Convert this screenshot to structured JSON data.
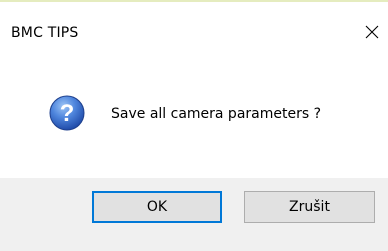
{
  "window": {
    "title": "BMC TIPS"
  },
  "icons": {
    "message_icon": "question-icon",
    "close_icon": "close-icon"
  },
  "message": {
    "text": "Save all camera parameters ?"
  },
  "buttons": {
    "ok_label": "OK",
    "cancel_label": "Zrušit"
  },
  "colors": {
    "question_icon_gradient_light": "#6f9fe6",
    "question_icon_gradient_dark": "#1d4fb0",
    "default_button_border": "#0078d7",
    "button_background": "#e1e1e1",
    "footer_background": "#f0f0f0"
  }
}
